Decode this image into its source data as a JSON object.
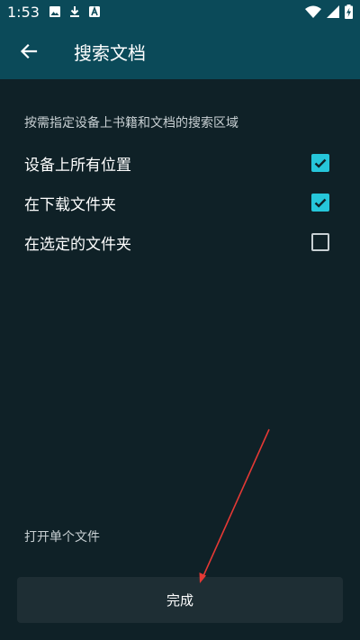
{
  "status_bar": {
    "time": "1:53",
    "icons": [
      "image-icon",
      "download-icon",
      "app-a-icon",
      "wifi-icon",
      "signal-icon",
      "battery-charging-icon"
    ]
  },
  "app_bar": {
    "title": "搜索文档",
    "back_icon": "arrow-back-icon"
  },
  "main": {
    "description": "按需指定设备上书籍和文档的搜索区域",
    "options": [
      {
        "label": "设备上所有位置",
        "checked": true
      },
      {
        "label": "在下载文件夹",
        "checked": true
      },
      {
        "label": "在选定的文件夹",
        "checked": false
      }
    ],
    "open_single_file": "打开单个文件",
    "done_label": "完成"
  },
  "colors": {
    "background": "#0f2127",
    "app_bar": "#0b4a59",
    "accent": "#26c6da",
    "button": "#1e2e34",
    "annotation_arrow": "#e53935"
  }
}
